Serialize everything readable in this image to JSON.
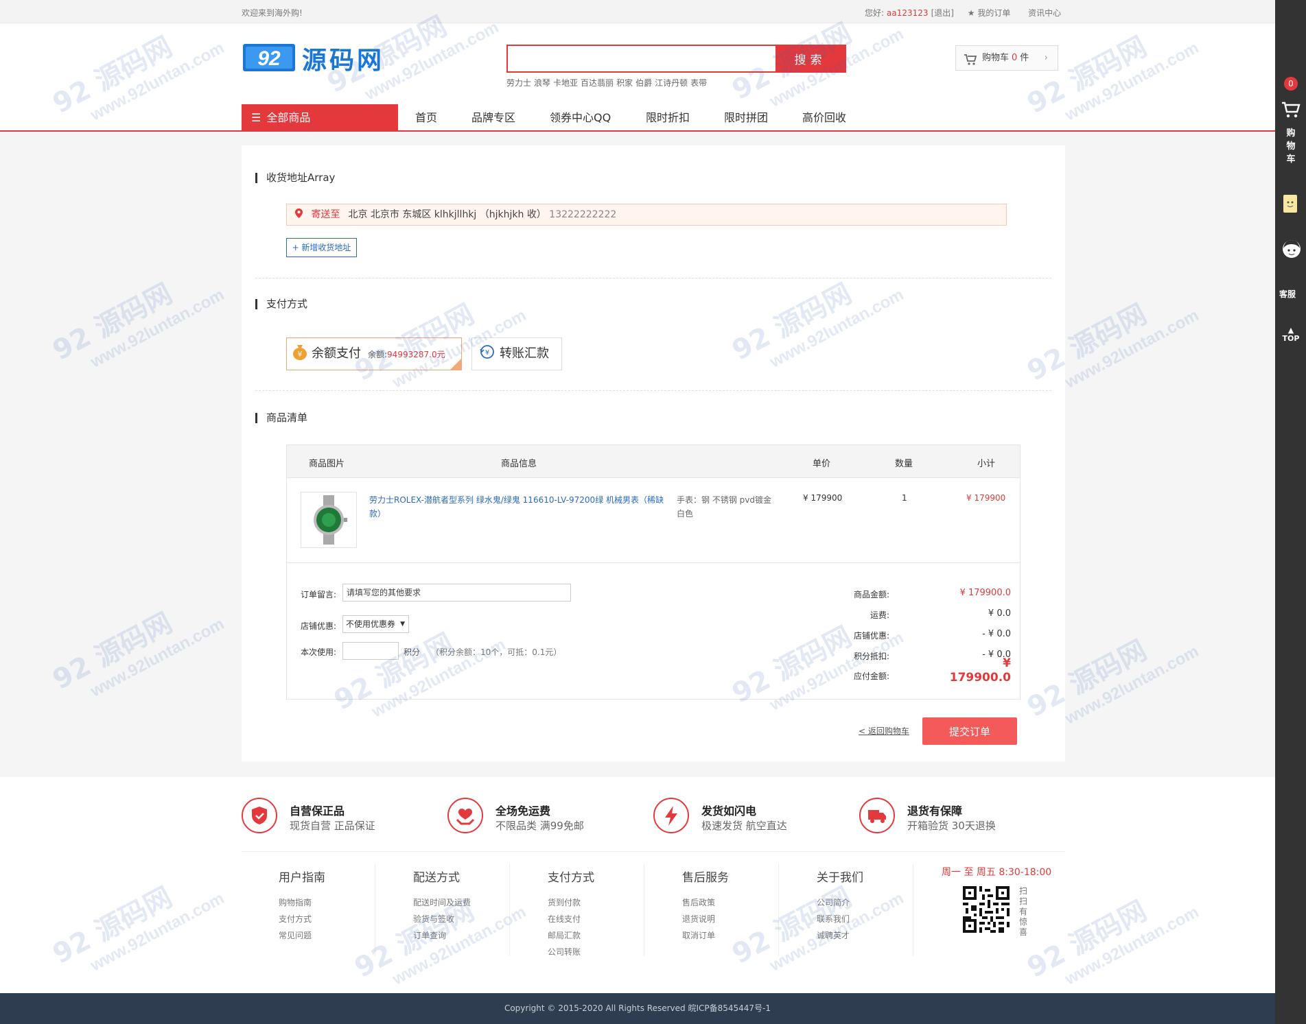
{
  "topbar": {
    "welcome": "欢迎来到海外购!",
    "greeting": "您好:",
    "username": "aa123123",
    "logout": "[退出]",
    "my_orders": "★ 我的订单",
    "news": "资讯中心"
  },
  "header": {
    "logo_badge": "92",
    "logo_text": "源码网",
    "search_placeholder": "",
    "search_button": "搜索",
    "hotwords": [
      "劳力士",
      "浪琴",
      "卡地亚",
      "百达翡丽",
      "积家",
      "伯爵",
      "江诗丹顿",
      "表带"
    ],
    "cart_label": "购物车",
    "cart_count": "0",
    "cart_unit": "件"
  },
  "nav": {
    "all_goods": "全部商品",
    "items": [
      "首页",
      "品牌专区",
      "领券中心QQ",
      "限时折扣",
      "限时拼团",
      "高价回收"
    ]
  },
  "address": {
    "title": "收货地址Array",
    "send_to": "寄送至",
    "detail": "北京 北京市 东城区 klhkjllhkj （hjkhjkh 收）",
    "phone": "13222222222",
    "add_button": "+ 新增收货地址"
  },
  "payment": {
    "title": "支付方式",
    "balance_label": "余额支付",
    "balance_prefix": "余额:",
    "balance_value": "94993287.0元",
    "transfer_label": "转账汇款"
  },
  "goods": {
    "title": "商品清单",
    "headers": [
      "商品图片",
      "商品信息",
      "单价",
      "数量",
      "小计"
    ],
    "item": {
      "name": "劳力士ROLEX-潜航者型系列 绿水鬼/绿鬼 116610-LV-97200绿 机械男表（稀缺款）",
      "spec": "手表：钢 不锈钢 pvd镀金 白色",
      "price": "¥ 179900",
      "qty": "1",
      "subtotal": "¥ 179900"
    },
    "memo_label": "订单留言:",
    "memo_placeholder": "请填写您的其他要求",
    "coupon_label": "店铺优惠:",
    "coupon_value": "不使用优惠券",
    "points_label": "本次使用:",
    "points_unit": "积分",
    "points_note": "（积分余额：10个，可抵：0.1元）"
  },
  "summary": {
    "goods_amount_label": "商品金额:",
    "goods_amount": "¥ 179900.0",
    "shipping_label": "运费:",
    "shipping": "¥ 0.0",
    "shop_discount_label": "店铺优惠:",
    "shop_discount": "- ¥ 0.0",
    "points_deduct_label": "积分抵扣:",
    "points_deduct": "- ¥ 0.0",
    "payable_label": "应付金额:",
    "payable_currency": "¥",
    "payable": "179900.0"
  },
  "actions": {
    "back": "< 返回购物车",
    "submit": "提交订单"
  },
  "services": [
    {
      "title": "自营保正品",
      "desc": "现货自营 正品保证",
      "icon": "shield-icon"
    },
    {
      "title": "全场免运费",
      "desc": "不限品类 满99免邮",
      "icon": "heart-hands-icon"
    },
    {
      "title": "发货如闪电",
      "desc": "极速发货 航空直达",
      "icon": "lightning-icon"
    },
    {
      "title": "退货有保障",
      "desc": "开箱验货 30天退换",
      "icon": "truck-icon"
    }
  ],
  "footer_cols": [
    {
      "title": "用户指南",
      "links": [
        "购物指南",
        "支付方式",
        "常见问题"
      ]
    },
    {
      "title": "配送方式",
      "links": [
        "配送时间及运费",
        "验货与签收",
        "订单查询"
      ]
    },
    {
      "title": "支付方式",
      "links": [
        "货到付款",
        "在线支付",
        "邮局汇款",
        "公司转账"
      ]
    },
    {
      "title": "售后服务",
      "links": [
        "售后政策",
        "退货说明",
        "取消订单"
      ]
    },
    {
      "title": "关于我们",
      "links": [
        "公司简介",
        "联系我们",
        "诚聘英才"
      ]
    }
  ],
  "service_hours": "周一 至 周五    8:30-18:00",
  "qr_text": "扫扫有惊喜",
  "copyright": "Copyright © 2015-2020 All Rights Reserved 皖ICP备8545447号-1",
  "sidebar": {
    "cart_badge": "0",
    "cart_text": "购物车",
    "service": "客服",
    "top": "TOP"
  },
  "watermark": {
    "big": "92 源码网",
    "small": "www.92luntan.com"
  },
  "colors": {
    "accent": "#e4393c",
    "link": "#2b69c2",
    "footer": "#2e3d4f"
  }
}
